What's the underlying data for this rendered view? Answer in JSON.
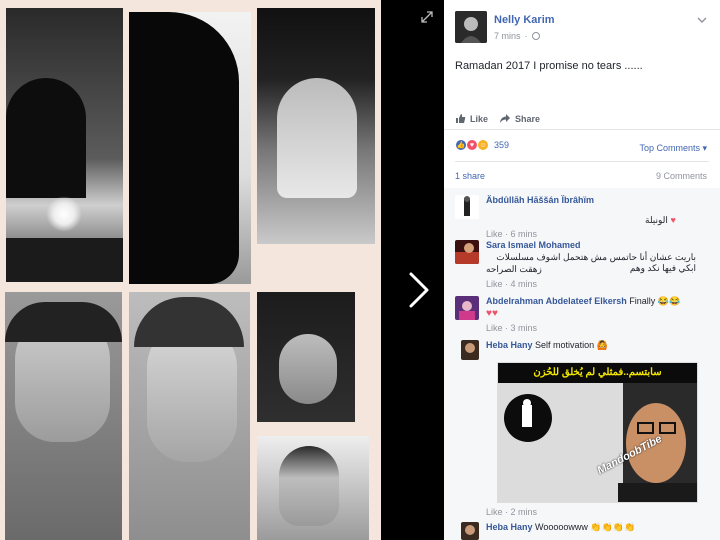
{
  "post": {
    "author": "Nelly Karim",
    "time": "7 mins",
    "text": "Ramadan 2017 I promise no tears ......",
    "like_label": "Like",
    "share_label": "Share",
    "reaction_count": "359",
    "top_comments_label": "Top Comments",
    "shares_label": "1 share",
    "comments_label": "9 Comments"
  },
  "comments": [
    {
      "name": "Äbdûllāh Hāššán Ïbrâhïm",
      "text": "الونيلة",
      "meta": "Like · 6 mins"
    },
    {
      "name": "Sara Ismael Mohamed",
      "text_line1": "باريت عشان أنا حاتمس مش هتحمل اشوف مسلسلات ابكي فيها نكد وهم",
      "text_line2": "زهقت الصراحه",
      "meta": "Like · 4 mins"
    },
    {
      "name": "Abdelrahman Abdelateef Elkersh",
      "text": "Finally",
      "meta": "Like · 3 mins"
    },
    {
      "name": "Heba Hany",
      "text": "Self motivation",
      "meme_caption": "سابتسم..فمثلي لم يُخلق للحُزن",
      "meme_watermark": "MandoobTibe",
      "meta": "Like · 2 mins"
    },
    {
      "name": "Heba Hany",
      "text": "Wooooowww"
    }
  ],
  "colors": {
    "link": "#4267b2",
    "collage_bg": "#f4e6dd",
    "meme_caption": "#f2e600"
  },
  "icons": [
    "expand-icon",
    "next-arrow-icon",
    "chevron-down-icon",
    "globe-icon",
    "like-icon",
    "share-icon"
  ]
}
